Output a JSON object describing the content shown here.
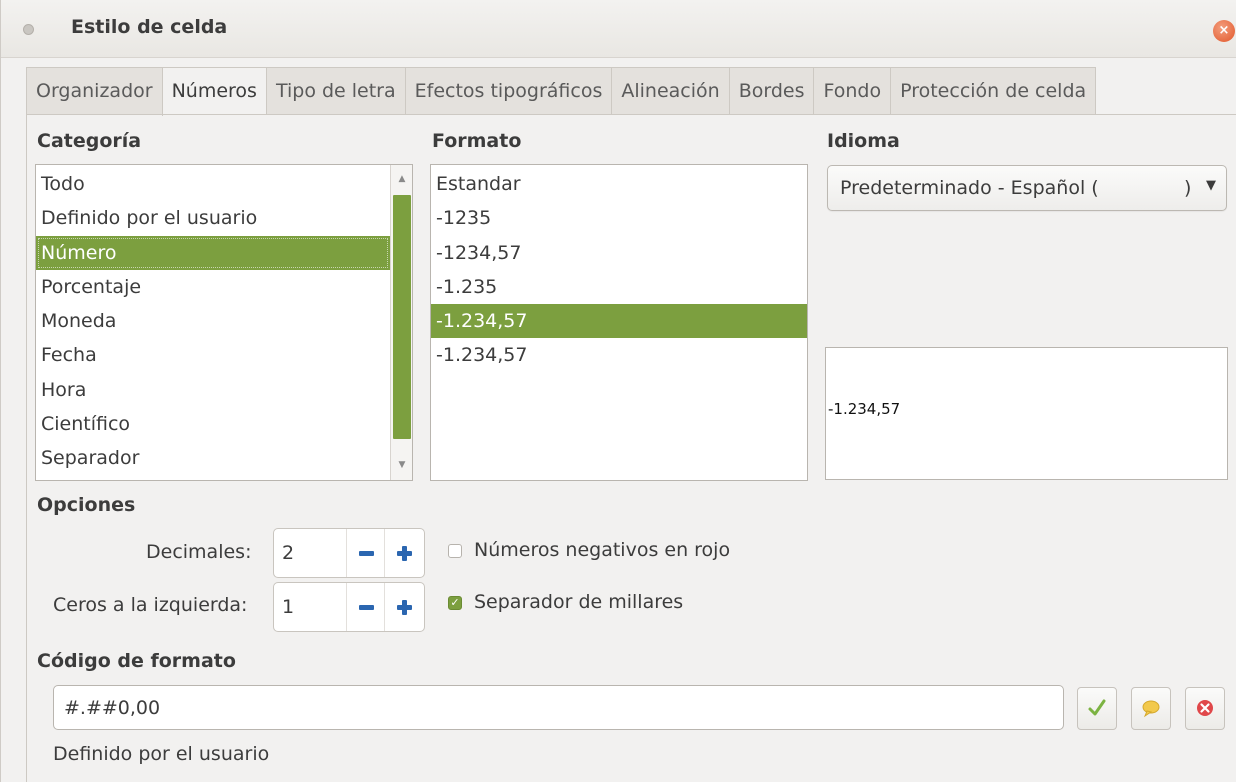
{
  "window": {
    "title": "Estilo de celda",
    "close_glyph": "×"
  },
  "tabs": [
    {
      "label": "Organizador",
      "active": false
    },
    {
      "label": "Números",
      "active": true
    },
    {
      "label": "Tipo de letra",
      "active": false
    },
    {
      "label": "Efectos tipográficos",
      "active": false
    },
    {
      "label": "Alineación",
      "active": false
    },
    {
      "label": "Bordes",
      "active": false
    },
    {
      "label": "Fondo",
      "active": false
    },
    {
      "label": "Protección de celda",
      "active": false
    }
  ],
  "category": {
    "label": "Categoría",
    "items": [
      "Todo",
      "Definido por el usuario",
      "Número",
      "Porcentaje",
      "Moneda",
      "Fecha",
      "Hora",
      "Científico",
      "Separador"
    ],
    "selected_index": 2
  },
  "format": {
    "label": "Formato",
    "items": [
      "Estandar",
      "-1235",
      "-1234,57",
      "-1.235",
      "-1.234,57",
      "-1.234,57"
    ],
    "selected_index": 4
  },
  "language": {
    "label": "Idioma",
    "value": "Predeterminado - Español (",
    "value_tail": ")"
  },
  "preview": {
    "text": "-1.234,57"
  },
  "options": {
    "label": "Opciones",
    "decimals_label": "Decimales:",
    "decimals_value": "2",
    "leading_zeros_label": "Ceros a la izquierda:",
    "leading_zeros_value": "1",
    "negative_red_label": "Números negativos en rojo",
    "negative_red_checked": false,
    "thousands_sep_label": "Separador de millares",
    "thousands_sep_checked": true
  },
  "format_code": {
    "label": "Código de formato",
    "value": "#.##0,00",
    "description": "Definido por el usuario"
  },
  "colors": {
    "accent": "#7c9f3f",
    "spin_icon": "#2b66b0",
    "delete_icon": "#e0484a",
    "comment_icon": "#f2c94c",
    "check_icon": "#7cb342"
  }
}
